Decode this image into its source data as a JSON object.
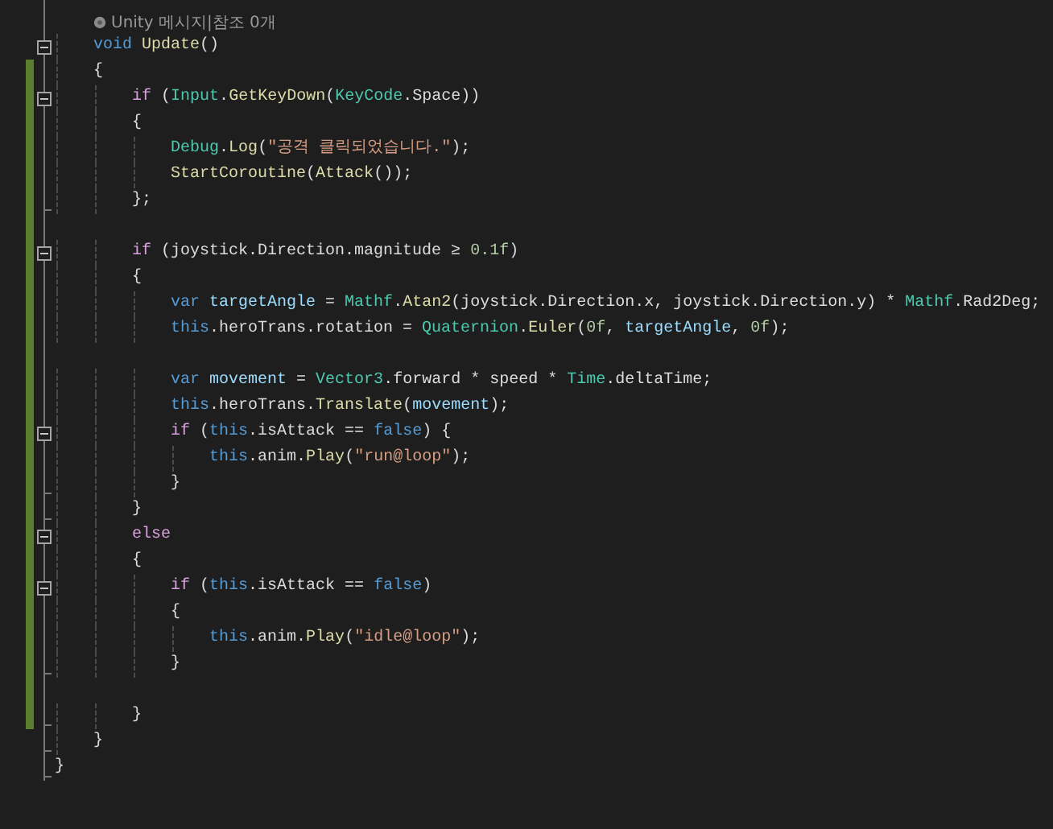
{
  "editor": {
    "lines": [
      {
        "kind": "code",
        "collapsible": false,
        "block_end": false,
        "changed": false
      },
      {
        "kind": "codelens",
        "collapsible": false,
        "block_end": false,
        "changed": false,
        "text": "Unity 메시지|참조 0개"
      },
      {
        "kind": "code",
        "collapsible": true,
        "block_end": false,
        "changed": false,
        "tokens": [
          {
            "kind": "kw",
            "s": "    void"
          },
          {
            "kind": "method",
            "s": " Update"
          },
          {
            "kind": "plain",
            "s": "()"
          }
        ]
      },
      {
        "kind": "code",
        "collapsible": false,
        "block_end": false,
        "changed": true,
        "tokens": [
          {
            "kind": "plain",
            "s": "    {"
          }
        ]
      },
      {
        "kind": "code",
        "collapsible": true,
        "block_end": false,
        "changed": true,
        "tokens": [
          {
            "kind": "ctl",
            "s": "        if"
          },
          {
            "kind": "plain",
            "s": " ("
          },
          {
            "kind": "type",
            "s": "Input"
          },
          {
            "kind": "plain",
            "s": "."
          },
          {
            "kind": "method",
            "s": "GetKeyDown"
          },
          {
            "kind": "plain",
            "s": "("
          },
          {
            "kind": "type",
            "s": "KeyCode"
          },
          {
            "kind": "plain",
            "s": ".Space))"
          }
        ]
      },
      {
        "kind": "code",
        "collapsible": false,
        "block_end": false,
        "changed": true,
        "tokens": [
          {
            "kind": "plain",
            "s": "        {"
          }
        ]
      },
      {
        "kind": "code",
        "collapsible": false,
        "block_end": false,
        "changed": true,
        "tokens": [
          {
            "kind": "type",
            "s": "            Debug"
          },
          {
            "kind": "plain",
            "s": "."
          },
          {
            "kind": "method",
            "s": "Log"
          },
          {
            "kind": "plain",
            "s": "("
          },
          {
            "kind": "str",
            "s": "\"공격 클릭되었습니다.\""
          },
          {
            "kind": "plain",
            "s": ");"
          }
        ]
      },
      {
        "kind": "code",
        "collapsible": false,
        "block_end": false,
        "changed": true,
        "tokens": [
          {
            "kind": "method",
            "s": "            StartCoroutine"
          },
          {
            "kind": "plain",
            "s": "("
          },
          {
            "kind": "method",
            "s": "Attack"
          },
          {
            "kind": "plain",
            "s": "());"
          }
        ]
      },
      {
        "kind": "code",
        "collapsible": false,
        "block_end": true,
        "changed": true,
        "tokens": [
          {
            "kind": "plain",
            "s": "        };"
          }
        ]
      },
      {
        "kind": "code",
        "collapsible": false,
        "block_end": false,
        "changed": true
      },
      {
        "kind": "code",
        "collapsible": true,
        "block_end": false,
        "changed": true,
        "tokens": [
          {
            "kind": "ctl",
            "s": "        if"
          },
          {
            "kind": "plain",
            "s": " (joystick.Direction.magnitude ≥ "
          },
          {
            "kind": "num",
            "s": "0.1f"
          },
          {
            "kind": "plain",
            "s": ")"
          }
        ]
      },
      {
        "kind": "code",
        "collapsible": false,
        "block_end": false,
        "changed": true,
        "tokens": [
          {
            "kind": "plain",
            "s": "        {"
          }
        ]
      },
      {
        "kind": "code",
        "collapsible": false,
        "block_end": false,
        "changed": true,
        "tokens": [
          {
            "kind": "kw",
            "s": "            var"
          },
          {
            "kind": "var",
            "s": " targetAngle"
          },
          {
            "kind": "plain",
            "s": " = "
          },
          {
            "kind": "type",
            "s": "Mathf"
          },
          {
            "kind": "plain",
            "s": "."
          },
          {
            "kind": "method",
            "s": "Atan2"
          },
          {
            "kind": "plain",
            "s": "(joystick.Direction.x, joystick.Direction.y) * "
          },
          {
            "kind": "type",
            "s": "Mathf"
          },
          {
            "kind": "plain",
            "s": ".Rad2Deg;"
          }
        ]
      },
      {
        "kind": "code",
        "collapsible": false,
        "block_end": false,
        "changed": true,
        "tokens": [
          {
            "kind": "kw",
            "s": "            this"
          },
          {
            "kind": "plain",
            "s": ".heroTrans.rotation = "
          },
          {
            "kind": "type",
            "s": "Quaternion"
          },
          {
            "kind": "plain",
            "s": "."
          },
          {
            "kind": "method",
            "s": "Euler"
          },
          {
            "kind": "plain",
            "s": "("
          },
          {
            "kind": "num",
            "s": "0f"
          },
          {
            "kind": "plain",
            "s": ", "
          },
          {
            "kind": "var",
            "s": "targetAngle"
          },
          {
            "kind": "plain",
            "s": ", "
          },
          {
            "kind": "num",
            "s": "0f"
          },
          {
            "kind": "plain",
            "s": ");"
          }
        ]
      },
      {
        "kind": "code",
        "collapsible": false,
        "block_end": false,
        "changed": true
      },
      {
        "kind": "code",
        "collapsible": false,
        "block_end": false,
        "changed": true,
        "tokens": [
          {
            "kind": "kw",
            "s": "            var"
          },
          {
            "kind": "var",
            "s": " movement"
          },
          {
            "kind": "plain",
            "s": " = "
          },
          {
            "kind": "type",
            "s": "Vector3"
          },
          {
            "kind": "plain",
            "s": ".forward * speed * "
          },
          {
            "kind": "type",
            "s": "Time"
          },
          {
            "kind": "plain",
            "s": ".deltaTime;"
          }
        ]
      },
      {
        "kind": "code",
        "collapsible": false,
        "block_end": false,
        "changed": true,
        "tokens": [
          {
            "kind": "kw",
            "s": "            this"
          },
          {
            "kind": "plain",
            "s": ".heroTrans."
          },
          {
            "kind": "method",
            "s": "Translate"
          },
          {
            "kind": "plain",
            "s": "("
          },
          {
            "kind": "var",
            "s": "movement"
          },
          {
            "kind": "plain",
            "s": ");"
          }
        ]
      },
      {
        "kind": "code",
        "collapsible": true,
        "block_end": false,
        "changed": true,
        "tokens": [
          {
            "kind": "ctl",
            "s": "            if"
          },
          {
            "kind": "plain",
            "s": " ("
          },
          {
            "kind": "kw",
            "s": "this"
          },
          {
            "kind": "plain",
            "s": ".isAttack == "
          },
          {
            "kind": "kw",
            "s": "false"
          },
          {
            "kind": "plain",
            "s": ") {"
          }
        ]
      },
      {
        "kind": "code",
        "collapsible": false,
        "block_end": false,
        "changed": true,
        "tokens": [
          {
            "kind": "kw",
            "s": "                this"
          },
          {
            "kind": "plain",
            "s": ".anim."
          },
          {
            "kind": "method",
            "s": "Play"
          },
          {
            "kind": "plain",
            "s": "("
          },
          {
            "kind": "str",
            "s": "\"run@loop\""
          },
          {
            "kind": "plain",
            "s": ");"
          }
        ]
      },
      {
        "kind": "code",
        "collapsible": false,
        "block_end": true,
        "changed": true,
        "tokens": [
          {
            "kind": "plain",
            "s": "            }"
          }
        ]
      },
      {
        "kind": "code",
        "collapsible": false,
        "block_end": true,
        "changed": true,
        "tokens": [
          {
            "kind": "plain",
            "s": "        }"
          }
        ]
      },
      {
        "kind": "code",
        "collapsible": true,
        "block_end": false,
        "changed": true,
        "tokens": [
          {
            "kind": "ctl",
            "s": "        else"
          }
        ]
      },
      {
        "kind": "code",
        "collapsible": false,
        "block_end": false,
        "changed": true,
        "tokens": [
          {
            "kind": "plain",
            "s": "        {"
          }
        ]
      },
      {
        "kind": "code",
        "collapsible": true,
        "block_end": false,
        "changed": true,
        "tokens": [
          {
            "kind": "ctl",
            "s": "            if"
          },
          {
            "kind": "plain",
            "s": " ("
          },
          {
            "kind": "kw",
            "s": "this"
          },
          {
            "kind": "plain",
            "s": ".isAttack == "
          },
          {
            "kind": "kw",
            "s": "false"
          },
          {
            "kind": "plain",
            "s": ")"
          }
        ]
      },
      {
        "kind": "code",
        "collapsible": false,
        "block_end": false,
        "changed": true,
        "tokens": [
          {
            "kind": "plain",
            "s": "            {"
          }
        ]
      },
      {
        "kind": "code",
        "collapsible": false,
        "block_end": false,
        "changed": true,
        "tokens": [
          {
            "kind": "kw",
            "s": "                this"
          },
          {
            "kind": "plain",
            "s": ".anim."
          },
          {
            "kind": "method",
            "s": "Play"
          },
          {
            "kind": "plain",
            "s": "("
          },
          {
            "kind": "str",
            "s": "\"idle@loop\""
          },
          {
            "kind": "plain",
            "s": ");"
          }
        ]
      },
      {
        "kind": "code",
        "collapsible": false,
        "block_end": true,
        "changed": true,
        "tokens": [
          {
            "kind": "plain",
            "s": "            }"
          }
        ]
      },
      {
        "kind": "code",
        "collapsible": false,
        "block_end": false,
        "changed": true
      },
      {
        "kind": "code",
        "collapsible": false,
        "block_end": true,
        "changed": true,
        "tokens": [
          {
            "kind": "plain",
            "s": "        }"
          }
        ]
      },
      {
        "kind": "code",
        "collapsible": false,
        "block_end": true,
        "changed": false,
        "tokens": [
          {
            "kind": "plain",
            "s": "    }"
          }
        ]
      },
      {
        "kind": "code",
        "collapsible": false,
        "block_end": true,
        "changed": false,
        "tokens": [
          {
            "kind": "plain",
            "s": "}"
          }
        ]
      }
    ]
  }
}
